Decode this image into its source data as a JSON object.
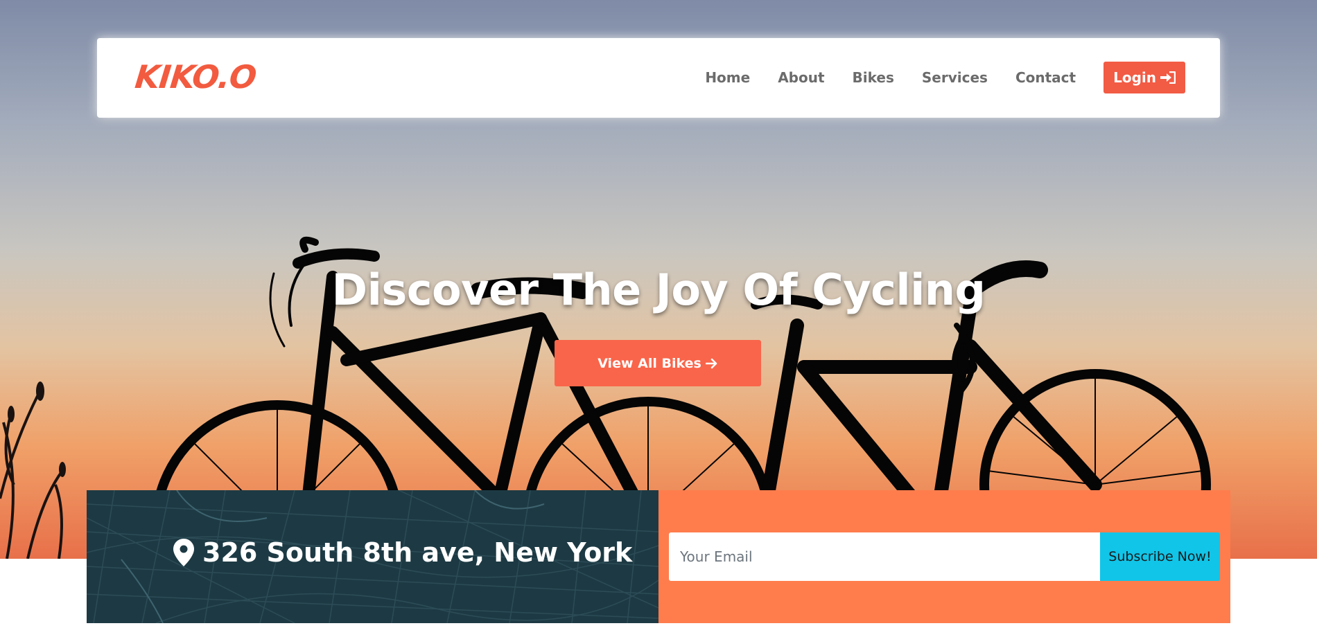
{
  "brand": {
    "logo_text": "KIKO.O"
  },
  "nav": {
    "links": [
      "Home",
      "About",
      "Bikes",
      "Services",
      "Contact"
    ],
    "login_label": "Login"
  },
  "hero": {
    "title": "Discover The Joy Of Cycling",
    "cta_label": "View All Bikes"
  },
  "info": {
    "address": "326 South 8th ave, New York",
    "email_placeholder": "Your Email",
    "subscribe_label": "Subscribe Now!"
  },
  "colors": {
    "accent": "#f25b44",
    "cta": "#f9654a",
    "dark_panel": "#1d3a44",
    "orange_panel": "#ff7d4d",
    "subscribe": "#11c5e8"
  },
  "icons": {
    "login": "sign-in-icon",
    "cta": "arrow-right-icon",
    "address": "map-marker-icon"
  }
}
